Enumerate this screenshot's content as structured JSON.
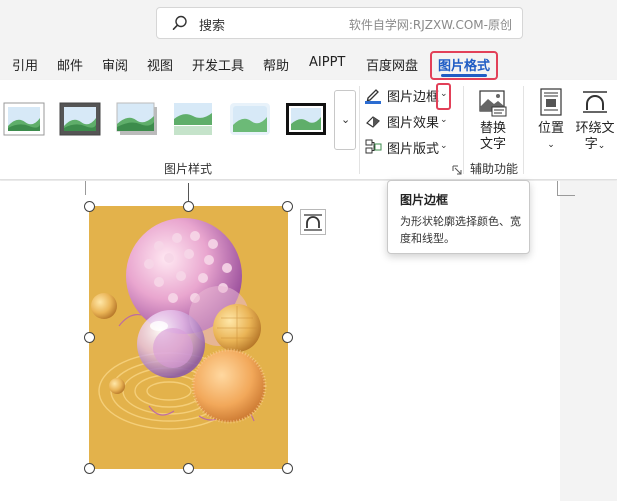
{
  "search": {
    "label": "搜索",
    "watermark": "软件自学网:RJZXW.COM-原创"
  },
  "tabs": [
    {
      "label": "引用"
    },
    {
      "label": "邮件"
    },
    {
      "label": "审阅"
    },
    {
      "label": "视图"
    },
    {
      "label": "开发工具"
    },
    {
      "label": "帮助"
    },
    {
      "label": "AIPPT"
    },
    {
      "label": "百度网盘"
    },
    {
      "label": "图片格式",
      "active": true
    }
  ],
  "ribbon": {
    "picture_styles": {
      "group_label": "图片样式",
      "more_glyph": "⌄"
    },
    "commands": {
      "border": "图片边框",
      "effects": "图片效果",
      "layout": "图片版式",
      "caret": "⌄"
    },
    "accessibility": {
      "alt_text_line1": "替换",
      "alt_text_line2": "文字",
      "group_label": "辅助功能"
    },
    "arrange": {
      "position_label": "位置",
      "wrap_line1": "环绕文",
      "wrap_line2": "字",
      "caret": "⌄"
    }
  },
  "tooltip": {
    "title": "图片边框",
    "description": "为形状轮廓选择颜色、宽度和线型。"
  },
  "colors": {
    "accent": "#1f5cc4",
    "highlight": "#e24058",
    "image_bg": "#e3b24b"
  }
}
